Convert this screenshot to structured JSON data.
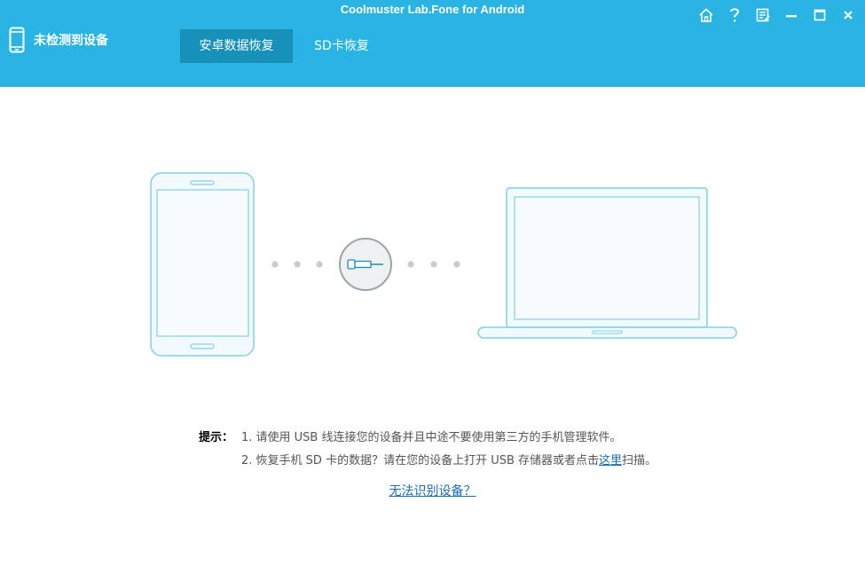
{
  "app": {
    "title": "Coolmuster Lab.Fone for Android"
  },
  "header": {
    "device_status": "未检测到设备",
    "device_icon": "phone-icon",
    "tabs": [
      {
        "label": "安卓数据恢复",
        "active": true
      },
      {
        "label": "SD卡恢复",
        "active": false
      }
    ],
    "window_controls": [
      {
        "name": "home-icon"
      },
      {
        "name": "help-icon"
      },
      {
        "name": "feedback-icon"
      },
      {
        "name": "minimize-icon"
      },
      {
        "name": "maximize-icon"
      },
      {
        "name": "close-icon"
      }
    ]
  },
  "illustration": {
    "left_device": "phone-illustration",
    "connector": "usb-cable-icon",
    "right_device": "laptop-illustration"
  },
  "tips": {
    "label": "提示：",
    "line1": "1. 请使用 USB 线连接您的设备并且中途不要使用第三方的手机管理软件。",
    "line2_prefix": "2. 恢复手机 SD 卡的数据？请在您的设备上打开 USB 存储器或者点击",
    "line2_link": "这里",
    "line2_suffix": "扫描。"
  },
  "help_link": "无法识别设备？",
  "colors": {
    "header_bg": "#2ab4e3",
    "active_tab_bg": "#1891ba",
    "device_outline": "#7fd0ea",
    "device_fill": "#f2fafd",
    "connector_circle": "#9aa6ad",
    "dots": "#c7cbcf",
    "link": "#1a6fb0"
  }
}
